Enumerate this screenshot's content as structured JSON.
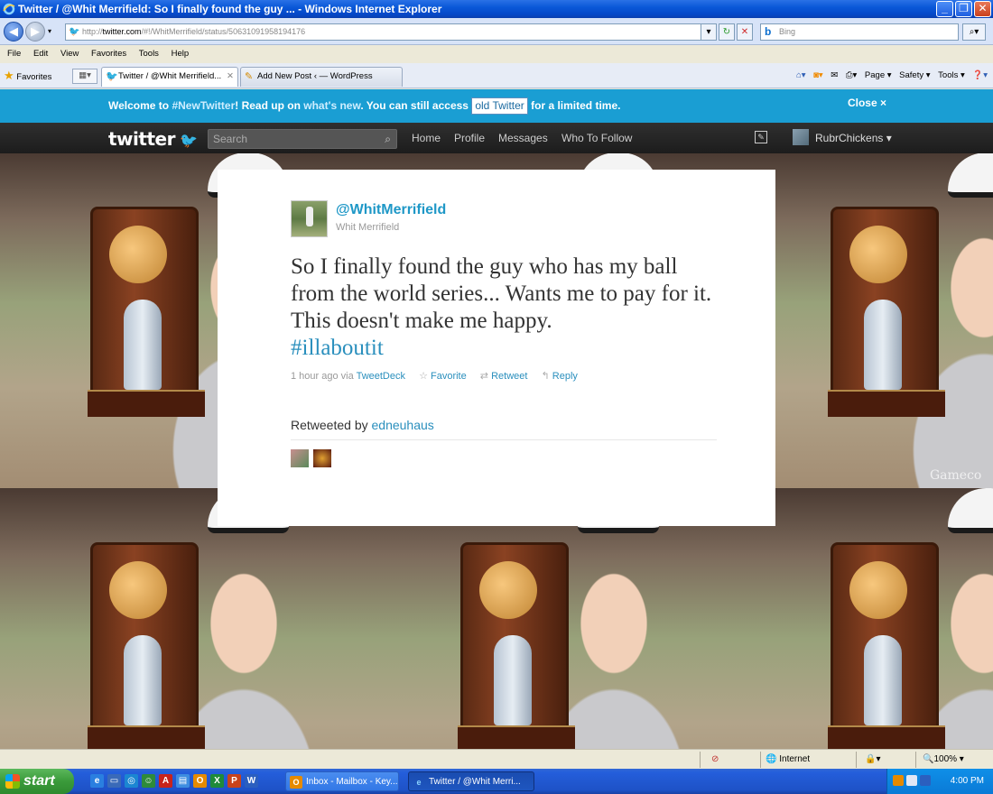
{
  "window": {
    "title": "Twitter / @Whit Merrifield: So I finally found the guy ... - Windows Internet Explorer"
  },
  "browser": {
    "address_protocol": "http://",
    "address_domain": "twitter.com",
    "address_path": "/#!/WhitMerrifield/status/50631091958194176",
    "search_placeholder": "Bing",
    "menu": [
      "File",
      "Edit",
      "View",
      "Favorites",
      "Tools",
      "Help"
    ],
    "favorites_label": "Favorites",
    "tabs": [
      {
        "label": "Twitter / @Whit Merrifield...",
        "active": true
      },
      {
        "label": "Add New Post ‹ — WordPress",
        "active": false
      }
    ],
    "command_bar": [
      "Page ▾",
      "Safety ▾",
      "Tools ▾"
    ]
  },
  "welcome_bar": {
    "text_1": "Welcome to ",
    "hashtag": "#NewTwitter",
    "text_2": "! Read up on ",
    "link": "what's new",
    "text_3": ". You can still access ",
    "old_twitter": "old Twitter",
    "text_4": " for a limited time.",
    "close": "Close ×"
  },
  "topbar": {
    "logo": "twitter",
    "search_placeholder": "Search",
    "nav": [
      "Home",
      "Profile",
      "Messages",
      "Who To Follow"
    ],
    "username": "RubrChickens ▾"
  },
  "tweet": {
    "handle": "@WhitMerrifield",
    "real_name": "Whit Merrifield",
    "text": "So I finally found the guy who has my ball from the world series... Wants me to pay for it. This doesn't make me happy.",
    "hashtag": "#illaboutit",
    "time": "1 hour ago via ",
    "source": "TweetDeck",
    "actions": [
      "Favorite",
      "Retweet",
      "Reply"
    ],
    "retweeted_by_label": "Retweeted by ",
    "retweeted_by_user": "edneuhaus"
  },
  "background_watermark": "Gameco",
  "statusbar": {
    "zone": "Internet",
    "zoom": "100%"
  },
  "taskbar": {
    "start": "start",
    "tasks": [
      {
        "label": "Inbox - Mailbox - Key...",
        "active": false
      },
      {
        "label": "Twitter / @Whit Merri...",
        "active": true
      }
    ],
    "clock": "4:00 PM"
  },
  "colors": {
    "twitter_blue": "#1a9ed3",
    "link_blue": "#2a8fbd",
    "topbar_dark": "#262626",
    "xp_blue": "#245edb"
  }
}
